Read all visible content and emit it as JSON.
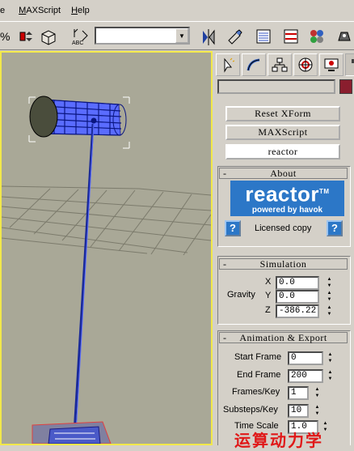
{
  "menubar": {
    "items": [
      {
        "label": "e"
      },
      {
        "label": "MAXScript",
        "mnemonic": "M"
      },
      {
        "label": "Help",
        "mnemonic": "H"
      }
    ]
  },
  "toolbar": {
    "named_selection_value": "",
    "icons": [
      "percent-snap-icon",
      "spinner-snap-icon",
      "box-icon",
      "named-selection-icon",
      "mirror-icon",
      "align-icon",
      "layer-manager-icon",
      "curve-editor-icon",
      "material-editor-icon",
      "render-icon"
    ]
  },
  "command_panel": {
    "tabs": [
      "create-tab",
      "modify-tab",
      "hierarchy-tab",
      "motion-tab",
      "display-tab",
      "utilities-tab"
    ],
    "active_tab": "utilities-tab",
    "object_name": "",
    "object_color": "#8a1e2e",
    "utilities": {
      "buttons": [
        {
          "label": "Reset XForm"
        },
        {
          "label": "MAXScript"
        },
        {
          "label": "reactor",
          "pressed": true
        }
      ]
    },
    "about": {
      "header": "About",
      "logo_title": "reactor",
      "logo_tm": "TM",
      "logo_subtitle": "powered by havok",
      "help_icon": "?",
      "license_text": "Licensed copy"
    },
    "simulation": {
      "header": "Simulation",
      "gravity_label": "Gravity",
      "x_label": "X",
      "x_value": "0.0",
      "y_label": "Y",
      "y_value": "0.0",
      "z_label": "Z",
      "z_value": "-386.22"
    },
    "animation_export": {
      "header": "Animation & Export",
      "start_frame_label": "Start Frame",
      "start_frame_value": "0",
      "end_frame_label": "End Frame",
      "end_frame_value": "200",
      "frames_key_label": "Frames/Key",
      "frames_key_value": "1",
      "substeps_key_label": "Substeps/Key",
      "substeps_key_value": "10",
      "time_scale_label": "Time Scale",
      "time_scale_value": "1.0"
    }
  },
  "watermark": "运算动力学"
}
